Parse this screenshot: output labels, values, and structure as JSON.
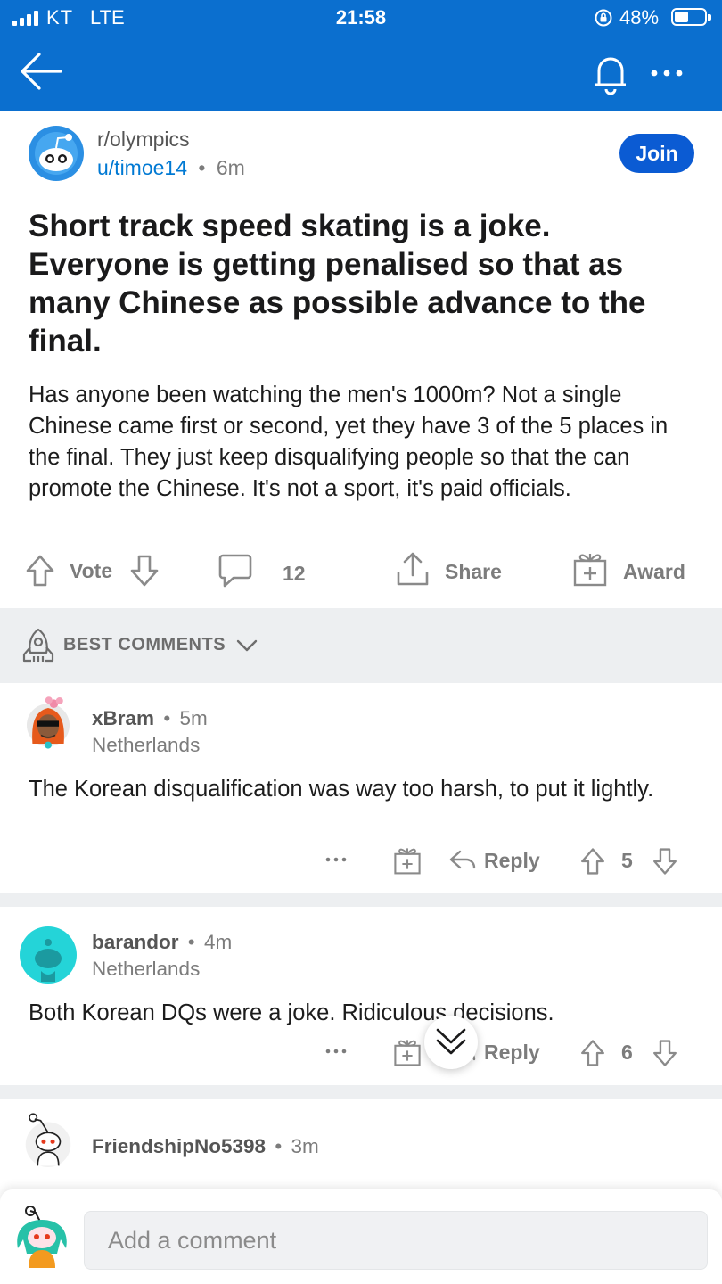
{
  "status_bar": {
    "carrier": "KT",
    "network": "LTE",
    "time": "21:58",
    "battery_percent": "48%",
    "battery_level": 0.48
  },
  "nav": {
    "back_icon": "arrow-left-icon",
    "notification_icon": "bell-icon",
    "more_icon": "more-horizontal-icon",
    "bar_color": "#0b6fcf"
  },
  "post": {
    "subreddit": "r/olympics",
    "author": "u/timoe14",
    "separator": "•",
    "age": "6m",
    "join_label": "Join",
    "title": "Short track speed skating is a joke. Everyone is getting penalised so that as many Chinese as possible advance to the final.",
    "body": "Has anyone been watching the men's 1000m? Not a single Chinese came first or second, yet they have 3 of the 5 places in the final. They just keep disqualifying people so that the can promote the Chinese. It's not a sport, it's paid officials.",
    "vote_label": "Vote",
    "comment_count": "12",
    "share_label": "Share",
    "award_label": "Award"
  },
  "comments_header": {
    "sort_label": "BEST COMMENTS",
    "icon": "rocket-icon"
  },
  "comments": [
    {
      "user": "xBram",
      "separator": "•",
      "age": "5m",
      "flair": "Netherlands",
      "body": "The Korean disqualification was way too harsh, to put it lightly.",
      "reply_label": "Reply",
      "score": "5"
    },
    {
      "user": "barandor",
      "separator": "•",
      "age": "4m",
      "flair": "Netherlands",
      "body": "Both Korean DQs were a joke. Ridiculous decisions.",
      "reply_label": "Reply",
      "score": "6"
    },
    {
      "user": "FriendshipNo5398",
      "separator": "•",
      "age": "3m"
    }
  ],
  "composer": {
    "placeholder": "Add a comment"
  },
  "colors": {
    "brand_blue": "#0b6fcf",
    "join_blue": "#0b5bd3",
    "link_blue": "#0079d3",
    "band_gray": "#edeff1"
  }
}
